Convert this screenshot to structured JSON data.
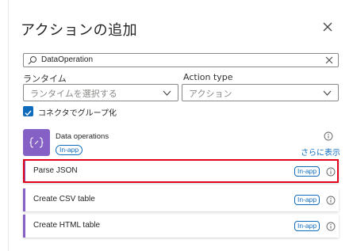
{
  "panel": {
    "title": "アクションの追加"
  },
  "search": {
    "value": "DataOperation"
  },
  "filters": {
    "runtime_label": "ランタイム",
    "runtime_placeholder": "ランタイムを選択する",
    "action_type_label": "Action type",
    "action_type_value": "アクション"
  },
  "group_by_connector": {
    "label": "コネクタでグループ化",
    "checked": true
  },
  "connector": {
    "name": "Data operations",
    "badge": "In-app",
    "more_link": "さらに表示",
    "icon": "curly-braces-icon",
    "color": "#8661c5"
  },
  "actions": [
    {
      "label": "Parse JSON",
      "badge": "In-app",
      "highlighted": true
    },
    {
      "label": "Create CSV table",
      "badge": "In-app"
    },
    {
      "label": "Create HTML table",
      "badge": "In-app"
    }
  ],
  "colors": {
    "accent": "#0f6cbd",
    "highlight": "#e3001b"
  }
}
